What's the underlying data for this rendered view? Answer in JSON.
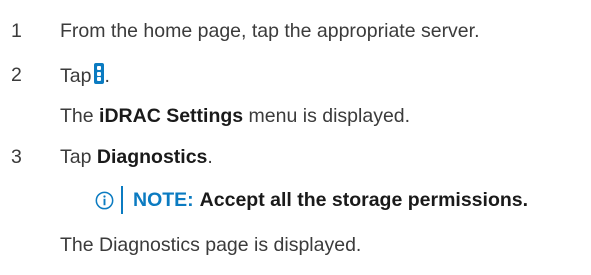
{
  "steps": [
    {
      "number": "1",
      "text": "From the home page, tap the appropriate server."
    },
    {
      "number": "2",
      "text_prefix": "Tap",
      "text_suffix": ".",
      "icon": "vertical-three-dot-menu-icon",
      "result_prefix": "The",
      "result_bold": "iDRAC Settings",
      "result_suffix": "menu is displayed."
    },
    {
      "number": "3",
      "text_prefix": "Tap",
      "text_bold": "Diagnostics",
      "text_suffix": "."
    }
  ],
  "note": {
    "icon": "info-circle-icon",
    "label": "NOTE:",
    "text": "Accept all the storage permissions."
  },
  "result": "The Diagnostics page is displayed.",
  "colors": {
    "accent": "#0b7bc1",
    "body_text": "#3b3b3b",
    "bold_text": "#1a1a1a"
  }
}
